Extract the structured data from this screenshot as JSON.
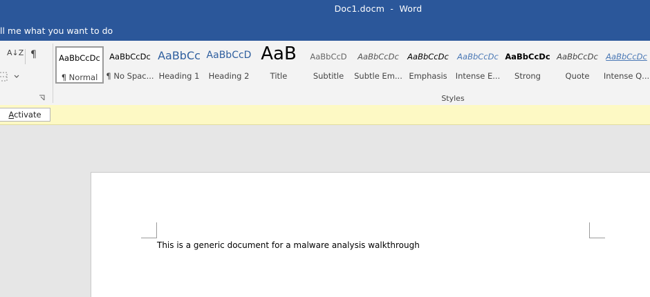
{
  "window": {
    "title": "Doc1.docm  -  Word"
  },
  "tell_me": {
    "placeholder": "ll me what you want to do"
  },
  "styles_group": {
    "label": "Styles",
    "items": [
      {
        "preview": "AaBbCcDc",
        "name": "¶ Normal"
      },
      {
        "preview": "AaBbCcDc",
        "name": "¶ No Spac..."
      },
      {
        "preview": "AaBbCc",
        "name": "Heading 1"
      },
      {
        "preview": "AaBbCcD",
        "name": "Heading 2"
      },
      {
        "preview": "AaB",
        "name": "Title"
      },
      {
        "preview": "AaBbCcD",
        "name": "Subtitle"
      },
      {
        "preview": "AaBbCcDc",
        "name": "Subtle Em..."
      },
      {
        "preview": "AaBbCcDc",
        "name": "Emphasis"
      },
      {
        "preview": "AaBbCcDc",
        "name": "Intense E..."
      },
      {
        "preview": "AaBbCcDc",
        "name": "Strong"
      },
      {
        "preview": "AaBbCcDc",
        "name": "Quote"
      },
      {
        "preview": "AaBbCcDc",
        "name": "Intense Q..."
      }
    ]
  },
  "paragraph_tools": {
    "sort_icon": "A↓Z",
    "pilcrow": "¶",
    "borders_icon": "borders-icon"
  },
  "message_bar": {
    "activate_label": "Activate"
  },
  "document": {
    "text": "This is a generic  document for a malware analysis walkthrough"
  },
  "colors": {
    "title_bar": "#2b579a",
    "message_bar": "#fdf9c4",
    "canvas": "#e6e6e6"
  }
}
